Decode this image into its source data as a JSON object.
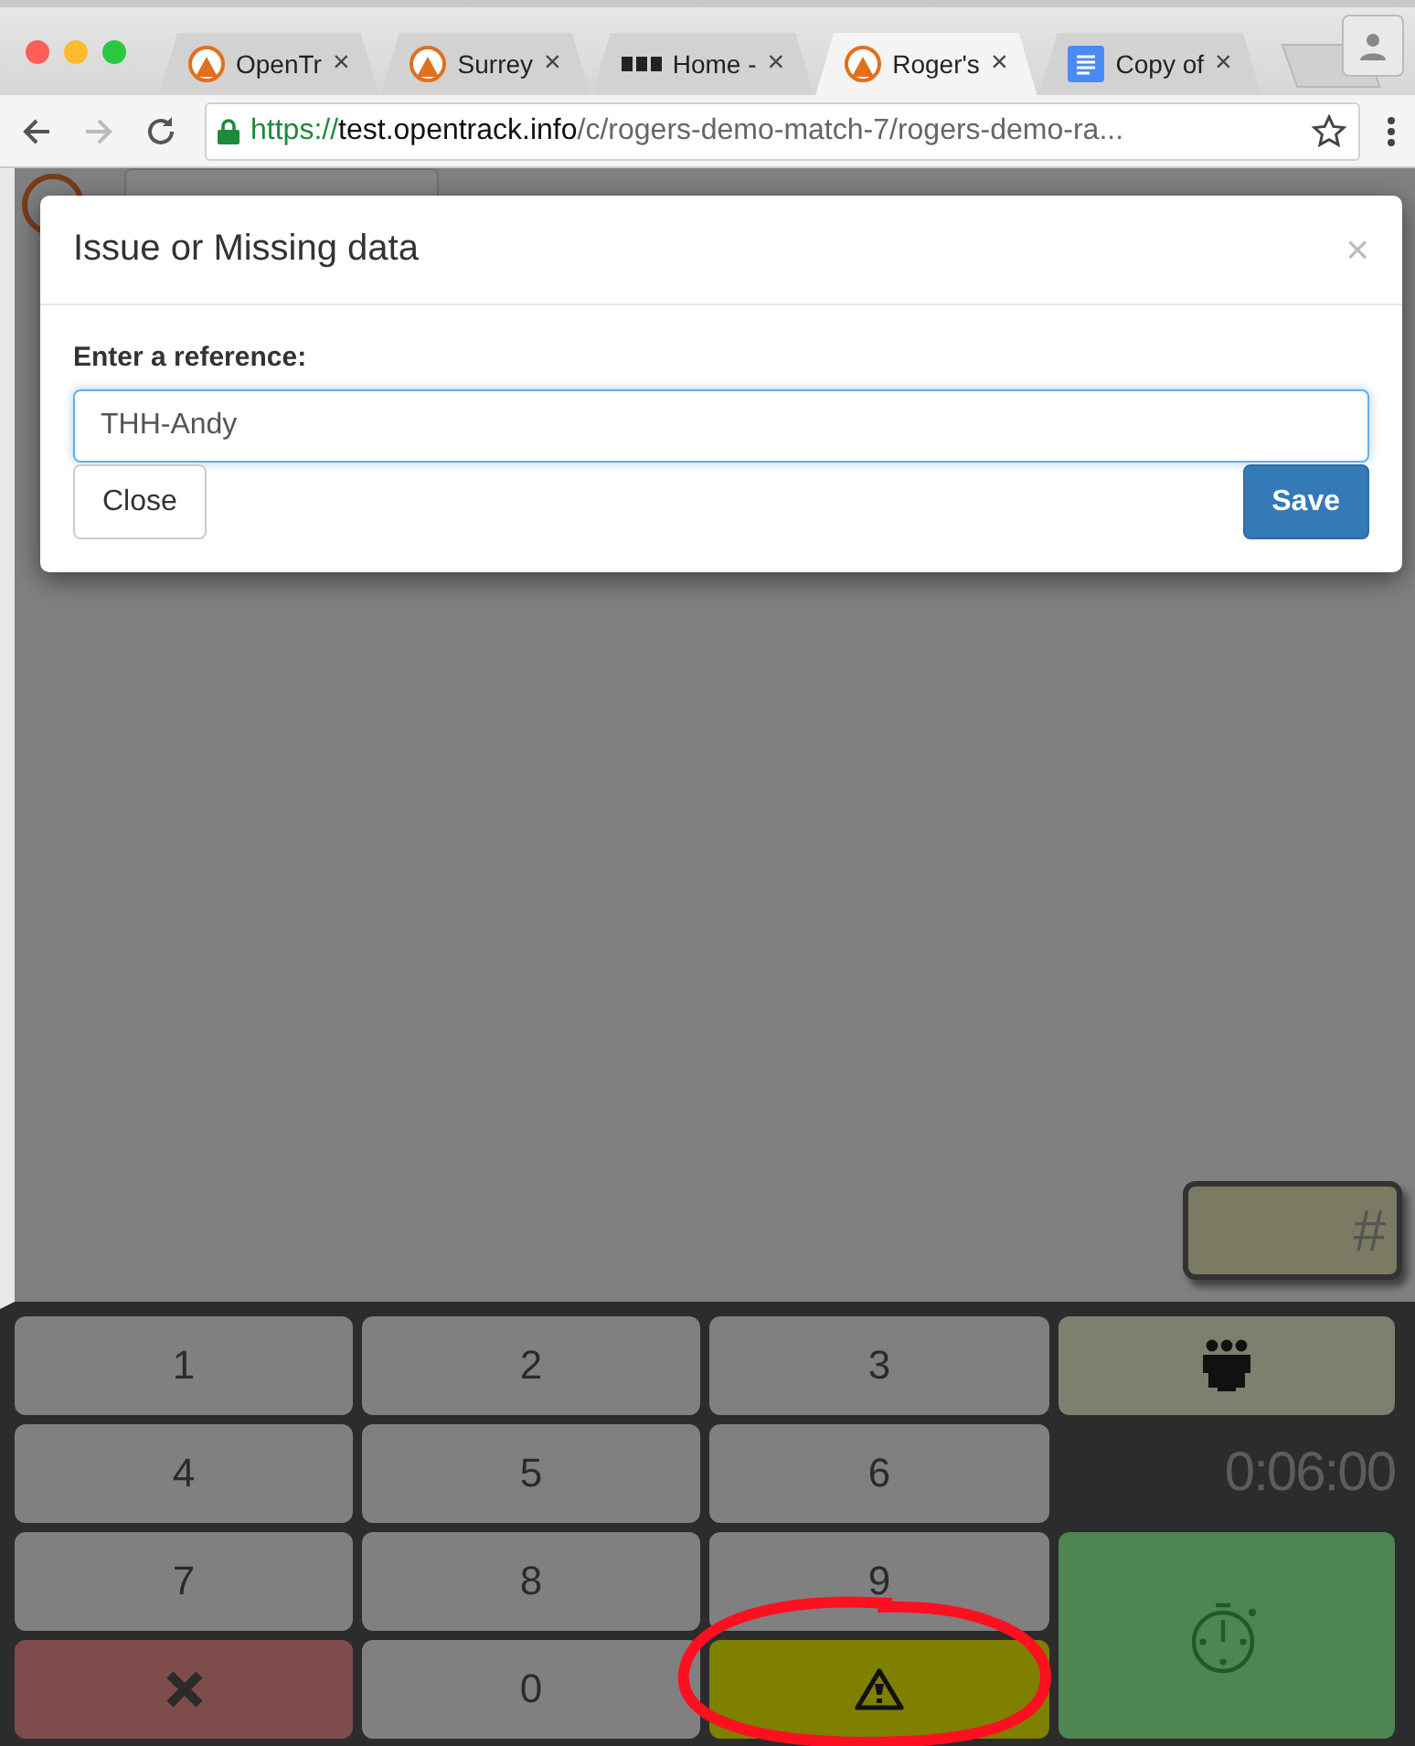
{
  "browser": {
    "tabs": [
      {
        "title": "OpenTr",
        "kind": "runner",
        "close_glyph": "×",
        "selected": false
      },
      {
        "title": "Surrey",
        "kind": "runner",
        "close_glyph": "×",
        "selected": false
      },
      {
        "title": "Home -",
        "kind": "blocks",
        "close_glyph": "×",
        "selected": false
      },
      {
        "title": "Roger's",
        "kind": "runner",
        "close_glyph": "×",
        "selected": true
      },
      {
        "title": "Copy of",
        "kind": "doc",
        "close_glyph": "×",
        "selected": false
      }
    ],
    "address": {
      "scheme": "https://",
      "host": "test.opentrack.info",
      "path": "/c/rogers-demo-match-7/rogers-demo-ra..."
    }
  },
  "modal": {
    "title": "Issue or Missing data",
    "close_glyph": "×",
    "field_label": "Enter a reference:",
    "field_value": "THH-Andy",
    "buttons": [
      {
        "label": "Close",
        "kind": "default"
      },
      {
        "label": "Save",
        "kind": "primary"
      }
    ]
  },
  "bib_field": {
    "placeholder": "#"
  },
  "keypad": [
    {
      "kind": "digit",
      "label": "1"
    },
    {
      "kind": "digit",
      "label": "2"
    },
    {
      "kind": "digit",
      "label": "3"
    },
    {
      "kind": "team"
    },
    {
      "kind": "digit",
      "label": "4"
    },
    {
      "kind": "digit",
      "label": "5"
    },
    {
      "kind": "digit",
      "label": "6"
    },
    {
      "kind": "timer",
      "label": "0:06:00"
    },
    {
      "kind": "digit",
      "label": "7"
    },
    {
      "kind": "digit",
      "label": "8"
    },
    {
      "kind": "digit",
      "label": "9"
    },
    {
      "kind": "start"
    },
    {
      "kind": "cancel"
    },
    {
      "kind": "digit",
      "label": "0"
    },
    {
      "kind": "warning"
    }
  ]
}
